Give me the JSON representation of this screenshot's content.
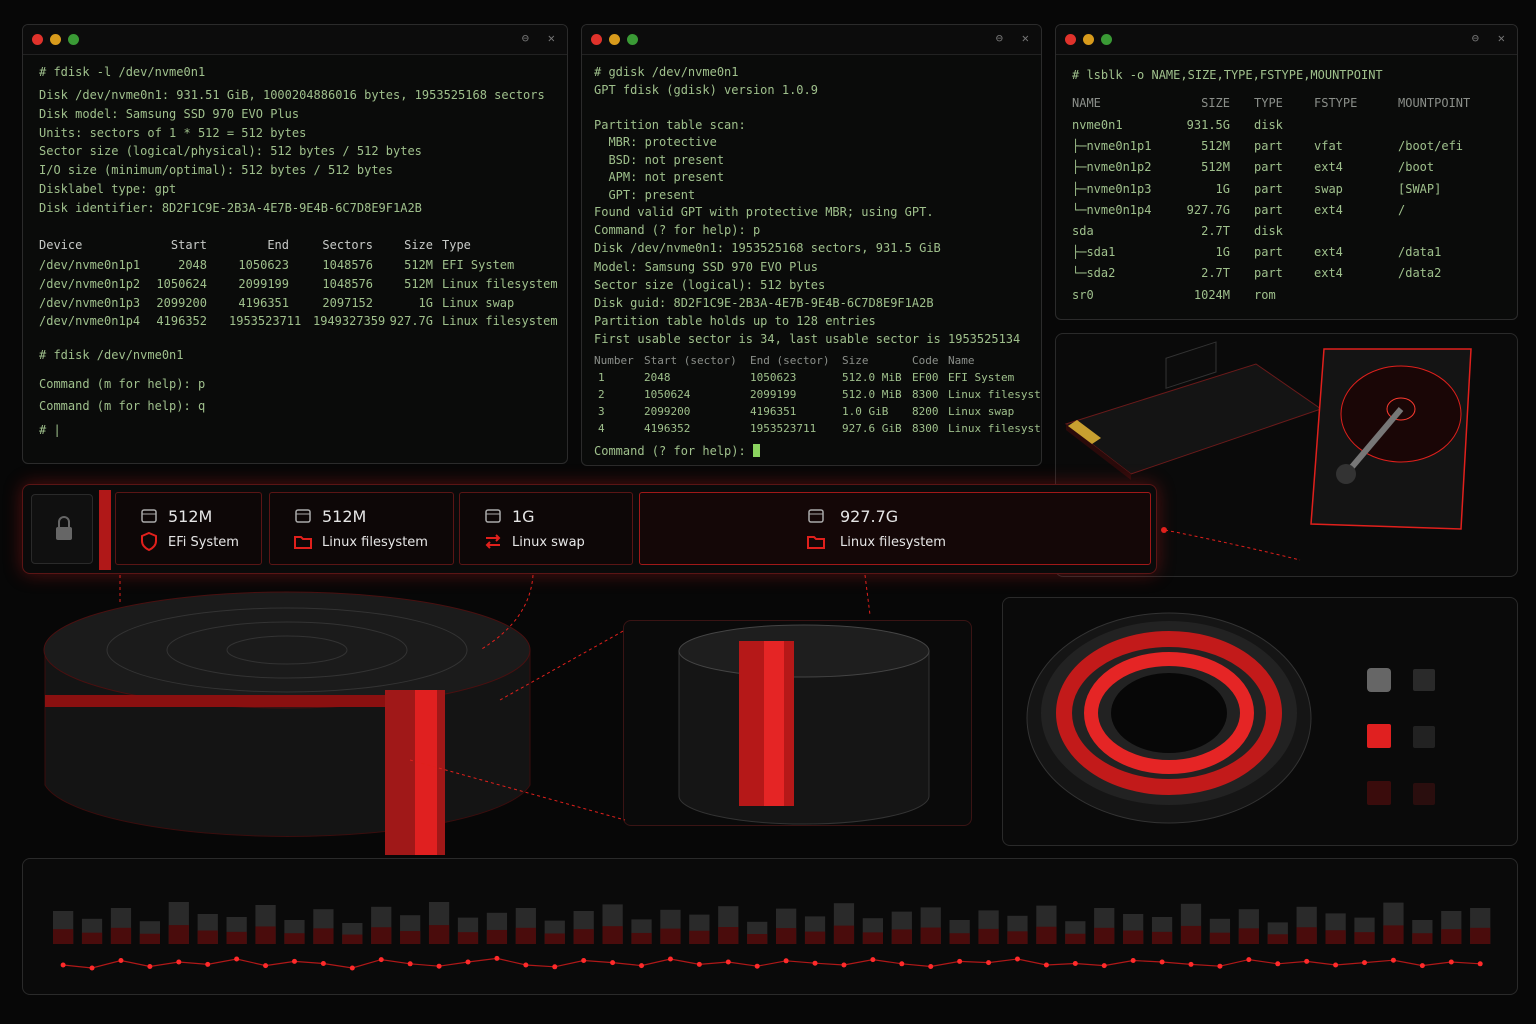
{
  "fdisk_window": {
    "command": "# fdisk -l /dev/nvme0n1",
    "info": [
      "Disk /dev/nvme0n1: 931.51 GiB, 1000204886016 bytes, 1953525168 sectors",
      "Disk model: Samsung SSD 970 EVO Plus",
      "Units: sectors of 1 * 512 = 512 bytes",
      "Sector size (logical/physical): 512 bytes / 512 bytes",
      "I/O size (minimum/optimal): 512 bytes / 512 bytes",
      "Disklabel type: gpt",
      "Disk identifier: 8D2F1C9E-2B3A-4E7B-9E4B-6C7D8E9F1A2B"
    ],
    "table_headers": [
      "Device",
      "Start",
      "End",
      "Sectors",
      "Size",
      "Type"
    ],
    "table_rows": [
      [
        "/dev/nvme0n1p1",
        "2048",
        "1050623",
        "1048576",
        "512M",
        "EFI System"
      ],
      [
        "/dev/nvme0n1p2",
        "1050624",
        "2099199",
        "1048576",
        "512M",
        "Linux filesystem"
      ],
      [
        "/dev/nvme0n1p3",
        "2099200",
        "4196351",
        "2097152",
        "1G",
        "Linux swap"
      ],
      [
        "/dev/nvme0n1p4",
        "4196352",
        "1953523711",
        "1949327359",
        "927.7G",
        "Linux filesystem"
      ]
    ],
    "command2": "# fdisk /dev/nvme0n1",
    "prompt1": "Command (m for help): p",
    "prompt2": "Command (m for help): q",
    "shell": "# |"
  },
  "gdisk_window": {
    "lines": [
      "# gdisk /dev/nvme0n1",
      "GPT fdisk (gdisk) version 1.0.9",
      "",
      "Partition table scan:",
      "  MBR: protective",
      "  BSD: not present",
      "  APM: not present",
      "  GPT: present"
    ],
    "lines2": [
      "Found valid GPT with protective MBR; using GPT.",
      "Command (? for help): p",
      "Disk /dev/nvme0n1: 1953525168 sectors, 931.5 GiB",
      "Model: Samsung SSD 970 EVO Plus",
      "Sector size (logical): 512 bytes",
      "Disk guid: 8D2F1C9E-2B3A-4E7B-9E4B-6C7D8E9F1A2B",
      "Partition table holds up to 128 entries",
      "First usable sector is 34, last usable sector is 1953525134"
    ],
    "table_headers": [
      "Number",
      "Start (sector)",
      "End (sector)",
      "Size",
      "Code",
      "Name"
    ],
    "table_rows": [
      [
        "1",
        "2048",
        "1050623",
        "512.0 MiB",
        "EF00",
        "EFI System"
      ],
      [
        "2",
        "1050624",
        "2099199",
        "512.0 MiB",
        "8300",
        "Linux filesystem"
      ],
      [
        "3",
        "2099200",
        "4196351",
        "1.0 GiB",
        "8200",
        "Linux swap"
      ],
      [
        "4",
        "4196352",
        "1953523711",
        "927.6 GiB",
        "8300",
        "Linux filesystem"
      ]
    ],
    "prompt": "Command (? for help): "
  },
  "lsblk_window": {
    "command": "# lsblk -o NAME,SIZE,TYPE,FSTYPE,MOUNTPOINT",
    "headers": [
      "NAME",
      "SIZE",
      "TYPE",
      "FSTYPE",
      "MOUNTPOINT"
    ],
    "rows": [
      [
        "nvme0n1",
        "931.5G",
        "disk",
        "",
        ""
      ],
      [
        "├─nvme0n1p1",
        "512M",
        "part",
        "vfat",
        "/boot/efi"
      ],
      [
        "├─nvme0n1p2",
        "512M",
        "part",
        "ext4",
        "/boot"
      ],
      [
        "├─nvme0n1p3",
        "1G",
        "part",
        "swap",
        "[SWAP]"
      ],
      [
        "└─nvme0n1p4",
        "927.7G",
        "part",
        "ext4",
        "/"
      ],
      [
        "sda",
        "2.7T",
        "disk",
        "",
        ""
      ],
      [
        "├─sda1",
        "1G",
        "part",
        "ext4",
        "/data1"
      ],
      [
        "└─sda2",
        "2.7T",
        "part",
        "ext4",
        "/data2"
      ],
      [
        "sr0",
        "1024M",
        "rom",
        "",
        ""
      ]
    ]
  },
  "partition_bar": [
    {
      "size": "512M",
      "label": "EFi System",
      "icon": "shield-icon"
    },
    {
      "size": "512M",
      "label": "Linux filesystem",
      "icon": "folder-icon"
    },
    {
      "size": "1G",
      "label": "Linux swap",
      "icon": "swap-arrows-icon"
    },
    {
      "size": "927.7G",
      "label": "Linux filesystem",
      "icon": "folder-icon"
    }
  ],
  "colors": {
    "accent": "#e0201c",
    "terminal_text": "#9fc08c",
    "background": "#070707"
  },
  "activity_chart": {
    "bars": [
      0.55,
      0.42,
      0.6,
      0.38,
      0.7,
      0.5,
      0.45,
      0.65,
      0.4,
      0.58,
      0.35,
      0.62,
      0.48,
      0.7,
      0.44,
      0.52,
      0.6,
      0.39,
      0.55,
      0.66,
      0.41,
      0.57,
      0.49,
      0.63,
      0.37,
      0.59,
      0.46,
      0.68,
      0.43,
      0.54,
      0.61,
      0.4,
      0.56,
      0.47,
      0.64,
      0.38,
      0.6,
      0.5,
      0.45,
      0.67,
      0.42,
      0.58,
      0.36,
      0.62,
      0.51,
      0.44,
      0.69,
      0.4,
      0.55,
      0.6
    ],
    "line": [
      0.4,
      0.3,
      0.55,
      0.35,
      0.5,
      0.42,
      0.6,
      0.38,
      0.52,
      0.45,
      0.3,
      0.58,
      0.44,
      0.36,
      0.5,
      0.62,
      0.4,
      0.34,
      0.55,
      0.48,
      0.38,
      0.6,
      0.42,
      0.5,
      0.36,
      0.54,
      0.46,
      0.4,
      0.58,
      0.44,
      0.35,
      0.52,
      0.48,
      0.6,
      0.4,
      0.45,
      0.38,
      0.55,
      0.5,
      0.42,
      0.36,
      0.58,
      0.44,
      0.52,
      0.4,
      0.48,
      0.56,
      0.38,
      0.5,
      0.44
    ]
  }
}
